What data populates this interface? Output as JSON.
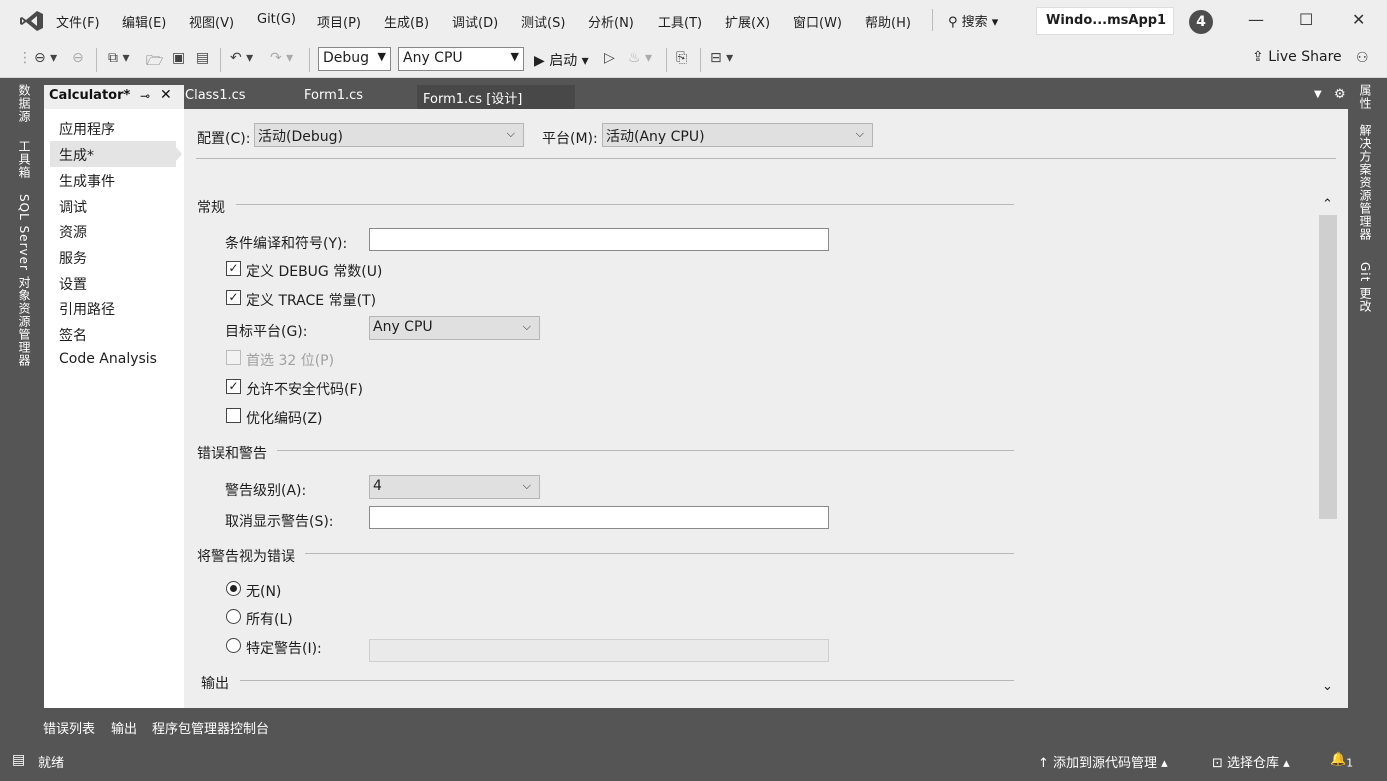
{
  "menu": {
    "items": [
      "文件(F)",
      "编辑(E)",
      "视图(V)",
      "Git(G)",
      "项目(P)",
      "生成(B)",
      "调试(D)",
      "测试(S)",
      "分析(N)",
      "工具(T)",
      "扩展(X)",
      "窗口(W)",
      "帮助(H)"
    ],
    "search_label": "搜索 ▾",
    "solution_name": "Windo...msApp1",
    "notification_count": "4"
  },
  "toolbar": {
    "config": "Debug",
    "platform": "Any CPU",
    "start_label": "启动",
    "live_share": "Live Share"
  },
  "side_tabs_left": [
    "数据源",
    "工具箱",
    "SQL Server 对象资源管理器"
  ],
  "side_tabs_right": [
    "属性",
    "解决方案资源管理器",
    "Git 更改"
  ],
  "doc_tabs": {
    "active": "Calculator*",
    "others": [
      "Class1.cs",
      "Form1.cs",
      "Form1.cs [设计]"
    ]
  },
  "nav": {
    "items": [
      "应用程序",
      "生成*",
      "生成事件",
      "调试",
      "资源",
      "服务",
      "设置",
      "引用路径",
      "签名",
      "Code Analysis"
    ],
    "selected_index": 1
  },
  "config_row": {
    "config_label": "配置(C):",
    "config_value": "活动(Debug)",
    "platform_label": "平台(M):",
    "platform_value": "活动(Any CPU)"
  },
  "general": {
    "heading": "常规",
    "symbols_label": "条件编译和符号(Y):",
    "symbols_value": "",
    "define_debug": {
      "label": "定义 DEBUG 常数(U)",
      "checked": true
    },
    "define_trace": {
      "label": "定义 TRACE 常量(T)",
      "checked": true
    },
    "target_label": "目标平台(G):",
    "target_value": "Any CPU",
    "prefer32": {
      "label": "首选 32 位(P)",
      "checked": false,
      "disabled": true
    },
    "unsafe": {
      "label": "允许不安全代码(F)",
      "checked": true
    },
    "optimize": {
      "label": "优化编码(Z)",
      "checked": false
    }
  },
  "errors": {
    "heading": "错误和警告",
    "level_label": "警告级别(A):",
    "level_value": "4",
    "suppress_label": "取消显示警告(S):",
    "suppress_value": ""
  },
  "treat": {
    "heading": "将警告视为错误",
    "none": "无(N)",
    "all": "所有(L)",
    "specific": "特定警告(I):",
    "selected": "none"
  },
  "output": {
    "heading": "输出"
  },
  "bottom_tabs": [
    "错误列表",
    "输出",
    "程序包管理器控制台"
  ],
  "status": {
    "ready": "就绪",
    "add_source": "添加到源代码管理",
    "select_repo": "选择仓库",
    "notifications": "1"
  }
}
